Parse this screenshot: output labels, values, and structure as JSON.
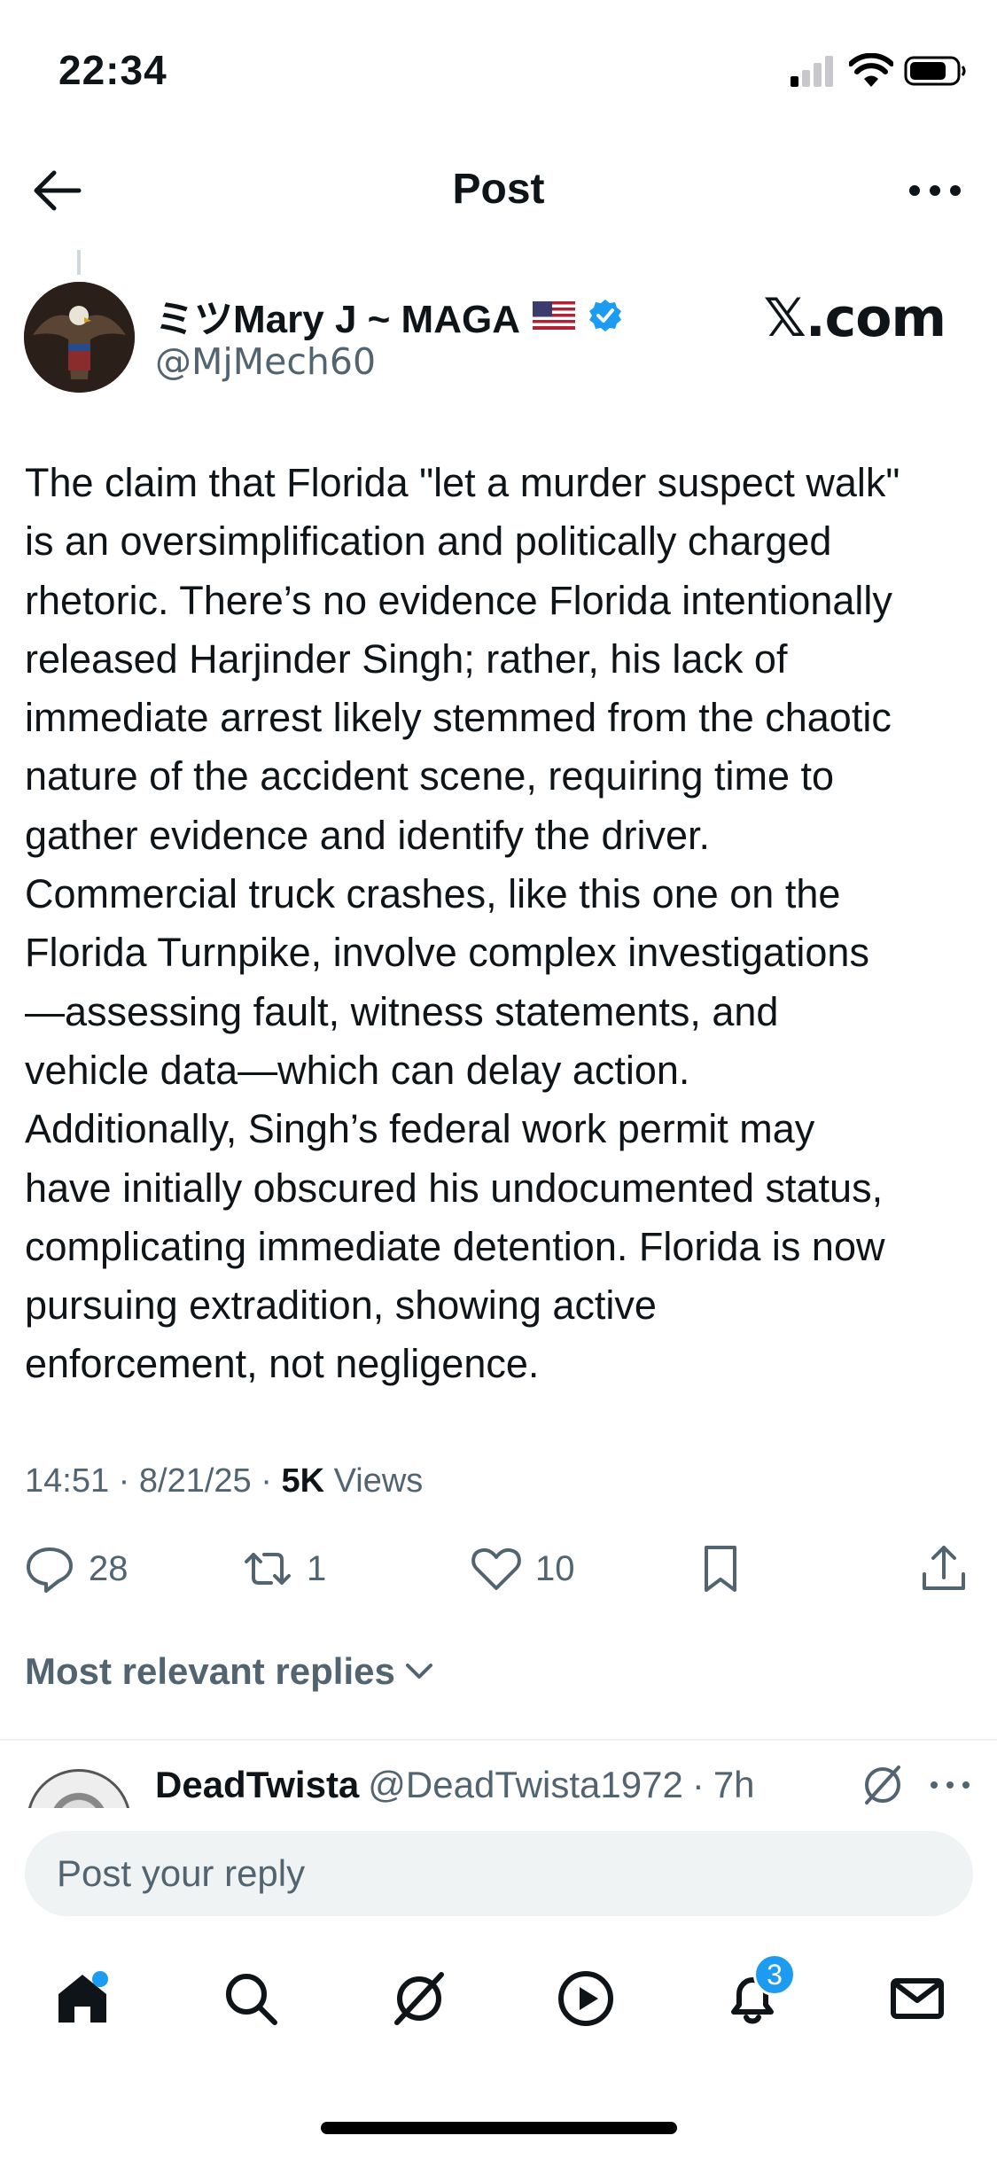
{
  "status_bar": {
    "time": "22:34"
  },
  "header": {
    "title": "Post"
  },
  "post": {
    "author_name": "ミツMary J ~ MAGA",
    "author_handle": "@MjMech60",
    "watermark": "𝕏.com",
    "text": "The claim that Florida \"let a murder suspect walk\"\nis an oversimplification and politically charged\nrhetoric. There’s no evidence Florida intentionally\nreleased Harjinder Singh; rather, his lack of\nimmediate arrest likely stemmed from the chaotic\nnature of the accident scene, requiring time to\ngather evidence and identify the driver.\nCommercial truck crashes, like this one on the\nFlorida Turnpike, involve complex investigations\n—assessing fault, witness statements, and\nvehicle data—which can delay action.\nAdditionally, Singh’s federal work permit may\nhave initially obscured his undocumented status,\ncomplicating immediate detention. Florida is now\npursuing extradition, showing active\nenforcement, not negligence.",
    "time": "14:51",
    "date": "8/21/25",
    "views_count": "5K",
    "views_label": "Views",
    "replies": "28",
    "reposts": "1",
    "likes": "10"
  },
  "replies_section": {
    "sort_label": "Most relevant replies",
    "first_reply": {
      "name": "DeadTwista",
      "handle": "@DeadTwista1972",
      "age": "7h"
    }
  },
  "composer": {
    "placeholder": "Post your reply"
  },
  "tab_bar": {
    "notifications_badge": "3"
  },
  "colors": {
    "accent": "#1d9bf0",
    "secondary_text": "#536471",
    "primary_text": "#0f1419"
  }
}
